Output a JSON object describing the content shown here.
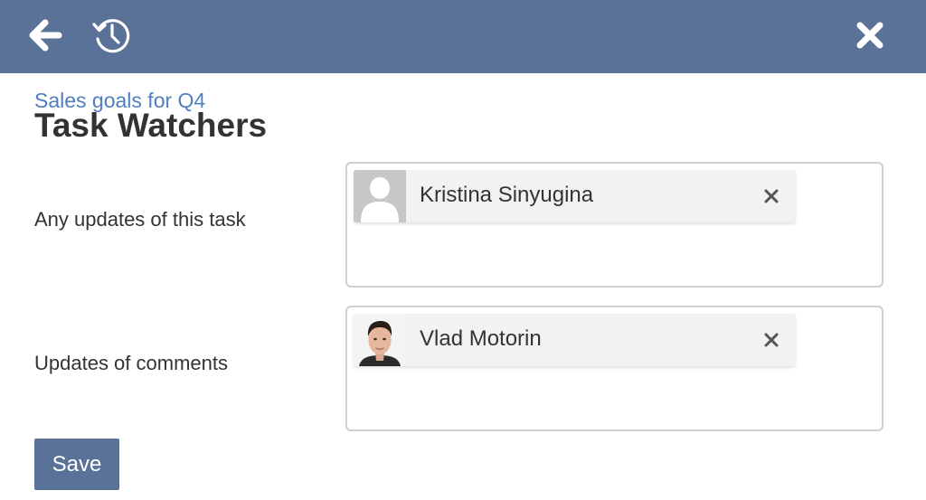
{
  "header": {
    "back_icon": "arrow-left-icon",
    "history_icon": "history-icon",
    "close_icon": "close-icon",
    "background_color": "#5a7298"
  },
  "breadcrumb": "Sales goals for Q4",
  "page_title": "Task Watchers",
  "watchers": [
    {
      "label": "Any updates of this task",
      "users": [
        {
          "name": "Kristina Sinyugina",
          "avatar": "placeholder-avatar-icon"
        }
      ]
    },
    {
      "label": "Updates of comments",
      "users": [
        {
          "name": "Vlad Motorin",
          "avatar": "user-photo"
        }
      ]
    }
  ],
  "save_label": "Save",
  "colors": {
    "accent": "#5a7298",
    "link": "#4f7fc1",
    "chip_bg": "#f2f2f2"
  }
}
